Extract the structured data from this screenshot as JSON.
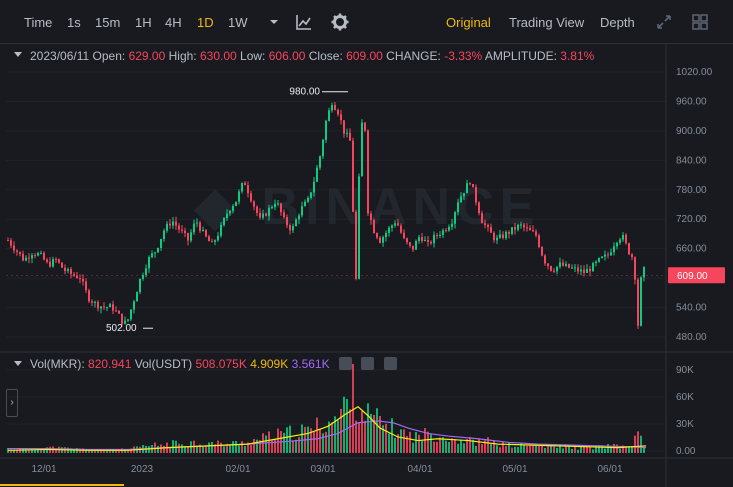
{
  "toolbar": {
    "time_label": "Time",
    "timeframes": [
      "1s",
      "15m",
      "1H",
      "4H",
      "1D",
      "1W"
    ],
    "active_timeframe": "1D",
    "views": [
      "Original",
      "Trading View",
      "Depth"
    ],
    "active_view": "Original"
  },
  "ohlc": {
    "date": "2023/06/11",
    "open_label": "Open:",
    "open": "629.00",
    "high_label": "High:",
    "high": "630.00",
    "low_label": "Low:",
    "low": "606.00",
    "close_label": "Close:",
    "close": "609.00",
    "change_label": "CHANGE:",
    "change": "-3.33%",
    "amplitude_label": "AMPLITUDE:",
    "amplitude": "3.81%"
  },
  "volume": {
    "vol_label": "Vol(MKR):",
    "vol_mkr": "820.941",
    "usdt_label": "Vol(USDT)",
    "vol_usdt": "508.075K",
    "ma1": "4.909K",
    "ma2": "3.561K"
  },
  "chart_data": {
    "type": "candlestick",
    "price_axis": {
      "ticks": [
        "1020.00",
        "960.00",
        "900.00",
        "840.00",
        "780.00",
        "720.00",
        "660.00",
        "600.00",
        "540.00",
        "480.00"
      ],
      "min": 460,
      "max": 1040
    },
    "volume_axis": {
      "ticks": [
        "90K",
        "60K",
        "30K",
        "0.00"
      ],
      "max": 100000
    },
    "x_ticks": [
      "12/01",
      "2023",
      "02/01",
      "03/01",
      "04/01",
      "05/01",
      "06/01"
    ],
    "last_price": "609.00",
    "high_marker": "980.00",
    "low_marker": "502.00",
    "close_path": [
      [
        0,
        680
      ],
      [
        8,
        660
      ],
      [
        16,
        640
      ],
      [
        24,
        655
      ],
      [
        32,
        650
      ],
      [
        40,
        630
      ],
      [
        48,
        640
      ],
      [
        56,
        620
      ],
      [
        64,
        610
      ],
      [
        72,
        605
      ],
      [
        80,
        565
      ],
      [
        88,
        550
      ],
      [
        96,
        545
      ],
      [
        104,
        545
      ],
      [
        110,
        530
      ],
      [
        116,
        510
      ],
      [
        120,
        520
      ],
      [
        126,
        560
      ],
      [
        132,
        600
      ],
      [
        140,
        640
      ],
      [
        148,
        660
      ],
      [
        156,
        700
      ],
      [
        164,
        720
      ],
      [
        172,
        700
      ],
      [
        180,
        680
      ],
      [
        188,
        720
      ],
      [
        196,
        690
      ],
      [
        204,
        670
      ],
      [
        212,
        700
      ],
      [
        220,
        740
      ],
      [
        228,
        760
      ],
      [
        236,
        800
      ],
      [
        244,
        760
      ],
      [
        252,
        720
      ],
      [
        260,
        740
      ],
      [
        268,
        760
      ],
      [
        276,
        720
      ],
      [
        284,
        700
      ],
      [
        292,
        740
      ],
      [
        300,
        760
      ],
      [
        306,
        800
      ],
      [
        312,
        850
      ],
      [
        318,
        920
      ],
      [
        324,
        960
      ],
      [
        330,
        940
      ],
      [
        336,
        900
      ],
      [
        342,
        880
      ],
      [
        348,
        600
      ],
      [
        352,
        870
      ],
      [
        356,
        960
      ],
      [
        360,
        740
      ],
      [
        366,
        700
      ],
      [
        372,
        680
      ],
      [
        380,
        700
      ],
      [
        388,
        720
      ],
      [
        396,
        680
      ],
      [
        404,
        660
      ],
      [
        412,
        690
      ],
      [
        420,
        670
      ],
      [
        428,
        690
      ],
      [
        436,
        700
      ],
      [
        444,
        720
      ],
      [
        450,
        760
      ],
      [
        456,
        780
      ],
      [
        462,
        800
      ],
      [
        468,
        760
      ],
      [
        474,
        720
      ],
      [
        480,
        700
      ],
      [
        488,
        680
      ],
      [
        496,
        690
      ],
      [
        504,
        700
      ],
      [
        512,
        710
      ],
      [
        520,
        700
      ],
      [
        528,
        690
      ],
      [
        536,
        640
      ],
      [
        544,
        620
      ],
      [
        552,
        630
      ],
      [
        560,
        625
      ],
      [
        568,
        620
      ],
      [
        576,
        615
      ],
      [
        584,
        625
      ],
      [
        592,
        640
      ],
      [
        600,
        650
      ],
      [
        608,
        680
      ],
      [
        614,
        690
      ],
      [
        620,
        660
      ],
      [
        626,
        640
      ],
      [
        630,
        509
      ],
      [
        634,
        630
      ],
      [
        638,
        609
      ]
    ],
    "volume_series": [
      [
        0,
        5
      ],
      [
        20,
        4
      ],
      [
        40,
        6
      ],
      [
        60,
        5
      ],
      [
        80,
        4
      ],
      [
        100,
        3
      ],
      [
        120,
        4
      ],
      [
        140,
        8
      ],
      [
        160,
        10
      ],
      [
        180,
        12
      ],
      [
        200,
        11
      ],
      [
        220,
        10
      ],
      [
        240,
        12
      ],
      [
        260,
        18
      ],
      [
        280,
        22
      ],
      [
        300,
        25
      ],
      [
        310,
        30
      ],
      [
        320,
        35
      ],
      [
        330,
        38
      ],
      [
        338,
        55
      ],
      [
        344,
        85
      ],
      [
        348,
        60
      ],
      [
        356,
        45
      ],
      [
        364,
        40
      ],
      [
        372,
        35
      ],
      [
        380,
        30
      ],
      [
        390,
        25
      ],
      [
        400,
        20
      ],
      [
        410,
        18
      ],
      [
        420,
        22
      ],
      [
        430,
        20
      ],
      [
        440,
        18
      ],
      [
        450,
        15
      ],
      [
        460,
        14
      ],
      [
        470,
        12
      ],
      [
        480,
        13
      ],
      [
        490,
        10
      ],
      [
        500,
        9
      ],
      [
        510,
        8
      ],
      [
        520,
        9
      ],
      [
        530,
        8
      ],
      [
        540,
        7
      ],
      [
        550,
        7
      ],
      [
        560,
        8
      ],
      [
        570,
        6
      ],
      [
        580,
        6
      ],
      [
        590,
        7
      ],
      [
        600,
        8
      ],
      [
        610,
        7
      ],
      [
        620,
        6
      ],
      [
        630,
        20
      ],
      [
        638,
        5
      ]
    ],
    "ma_yellow": [
      [
        0,
        3
      ],
      [
        40,
        4
      ],
      [
        80,
        3
      ],
      [
        120,
        3
      ],
      [
        160,
        6
      ],
      [
        200,
        8
      ],
      [
        240,
        10
      ],
      [
        270,
        16
      ],
      [
        300,
        22
      ],
      [
        320,
        30
      ],
      [
        338,
        44
      ],
      [
        350,
        52
      ],
      [
        360,
        42
      ],
      [
        372,
        28
      ],
      [
        390,
        18
      ],
      [
        410,
        14
      ],
      [
        430,
        16
      ],
      [
        460,
        14
      ],
      [
        490,
        10
      ],
      [
        520,
        9
      ],
      [
        550,
        8
      ],
      [
        580,
        7
      ],
      [
        610,
        6
      ],
      [
        638,
        8
      ]
    ],
    "ma_purple": [
      [
        0,
        5
      ],
      [
        40,
        5
      ],
      [
        80,
        4
      ],
      [
        120,
        4
      ],
      [
        160,
        6
      ],
      [
        200,
        8
      ],
      [
        240,
        10
      ],
      [
        280,
        13
      ],
      [
        310,
        16
      ],
      [
        330,
        22
      ],
      [
        350,
        34
      ],
      [
        370,
        36
      ],
      [
        385,
        34
      ],
      [
        400,
        28
      ],
      [
        420,
        22
      ],
      [
        440,
        19
      ],
      [
        470,
        16
      ],
      [
        500,
        12
      ],
      [
        530,
        10
      ],
      [
        560,
        9
      ],
      [
        590,
        8
      ],
      [
        620,
        7
      ],
      [
        638,
        6
      ]
    ],
    "colors": {
      "up": "#0ecb81",
      "down": "#f6465d",
      "ma_yellow": "#f0f011",
      "ma_purple": "#a26af7",
      "accent": "#f0b90b"
    }
  }
}
